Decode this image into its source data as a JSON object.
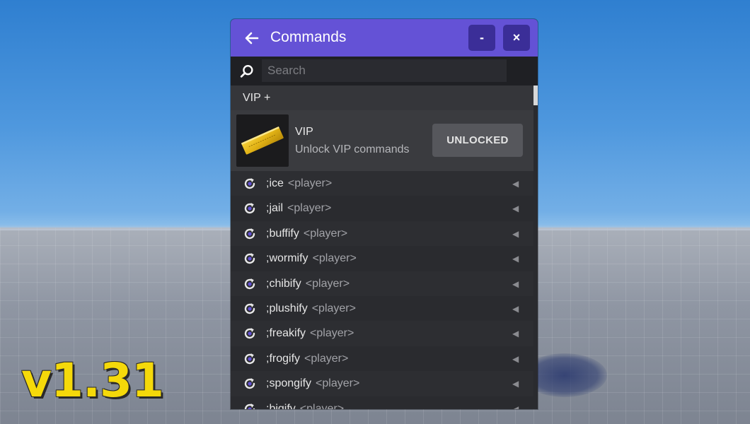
{
  "window": {
    "title": "Commands",
    "minimize_label": "-",
    "close_label": "×"
  },
  "search": {
    "placeholder": "Search",
    "value": ""
  },
  "section": {
    "label": "VIP +"
  },
  "vip": {
    "name": "VIP",
    "description": "Unlock VIP commands",
    "button_label": "UNLOCKED"
  },
  "commands": [
    {
      "name": ";ice",
      "arg": "<player>"
    },
    {
      "name": ";jail",
      "arg": "<player>"
    },
    {
      "name": ";buffify",
      "arg": "<player>"
    },
    {
      "name": ";wormify",
      "arg": "<player>"
    },
    {
      "name": ";chibify",
      "arg": "<player>"
    },
    {
      "name": ";plushify",
      "arg": "<player>"
    },
    {
      "name": ";freakify",
      "arg": "<player>"
    },
    {
      "name": ";frogify",
      "arg": "<player>"
    },
    {
      "name": ";spongify",
      "arg": "<player>"
    },
    {
      "name": ";bigify",
      "arg": "<player>"
    }
  ],
  "arrow_glyph": "◀",
  "overlay": {
    "version": "v1.31"
  },
  "colors": {
    "accent": "#6452d6",
    "button_dark": "#3b2e98",
    "version_text": "#f5d90a"
  }
}
